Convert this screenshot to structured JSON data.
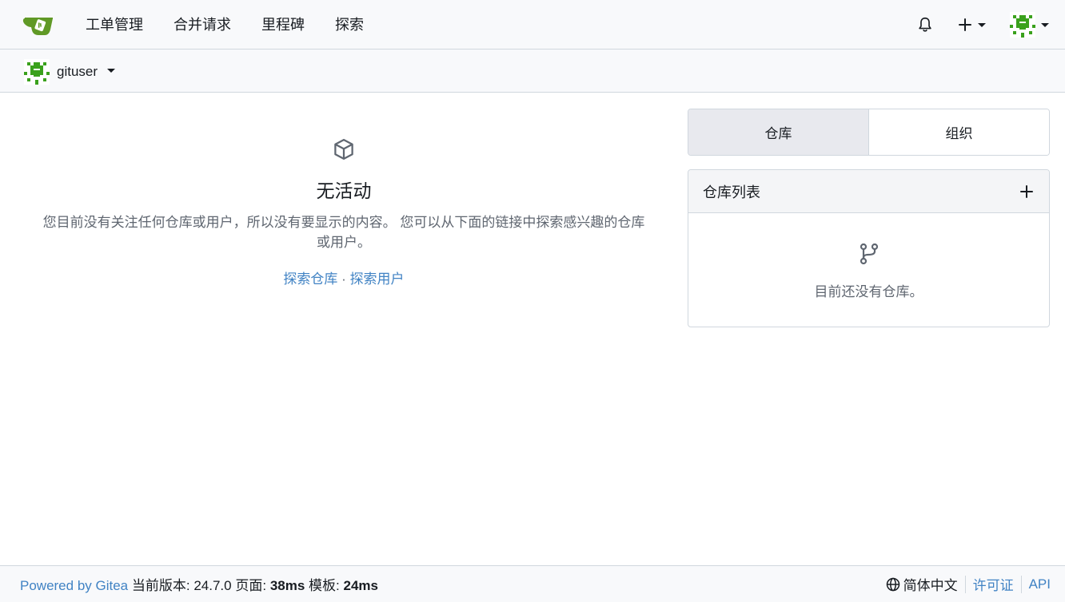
{
  "nav": {
    "links": [
      "工单管理",
      "合并请求",
      "里程碑",
      "探索"
    ]
  },
  "context": {
    "username": "gituser"
  },
  "feed": {
    "title": "无活动",
    "description": "您目前没有关注任何仓库或用户，所以没有要显示的内容。 您可以从下面的链接中探索感兴趣的仓库或用户。",
    "link_repos": "探索仓库",
    "link_dot": "·",
    "link_users": "探索用户"
  },
  "sidebar": {
    "tabs": [
      {
        "label": "仓库",
        "active": true
      },
      {
        "label": "组织",
        "active": false
      }
    ],
    "repo_list_title": "仓库列表",
    "empty_repos": "目前还没有仓库。"
  },
  "footer": {
    "powered_by": "Powered by Gitea",
    "version_label": "当前版本:",
    "version": "24.7.0",
    "page_label": "页面:",
    "page_time": "38ms",
    "template_label": "模板:",
    "template_time": "24ms",
    "language": "简体中文",
    "license": "许可证",
    "api": "API"
  },
  "colors": {
    "accent_link": "#4183c4",
    "brand_green": "#609926",
    "avatar_green": "#3aa11c"
  },
  "icons": {
    "logo": "gitea-logo",
    "notifications": "bell-icon",
    "create": "plus-icon",
    "avatar": "avatar",
    "empty_feed": "package-icon",
    "empty_repo": "repo-forked-icon",
    "language": "globe-icon"
  }
}
